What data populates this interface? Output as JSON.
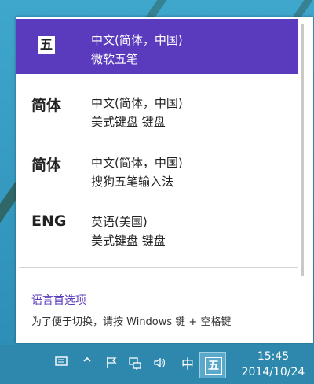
{
  "ime_flyout": {
    "items": [
      {
        "indicator": "五",
        "language": "中文(简体，中国)",
        "layout": "微软五笔",
        "selected": true
      },
      {
        "indicator": "简体",
        "language": "中文(简体，中国)",
        "layout": "美式键盘 键盘",
        "selected": false
      },
      {
        "indicator": "简体",
        "language": "中文(简体，中国)",
        "layout": "搜狗五笔输入法",
        "selected": false
      },
      {
        "indicator": "ENG",
        "language": "英语(美国)",
        "layout": "美式键盘 键盘",
        "selected": false
      }
    ],
    "preferences_link": "语言首选项",
    "switch_hint": "为了便于切换，请按 Windows 键 + 空格键"
  },
  "taskbar": {
    "tray_icons": [
      "action-center-icon",
      "show-hidden-icons-chevron",
      "flag-icon",
      "network-icon",
      "volume-icon"
    ],
    "language_indicator": "中",
    "ime_mode": "五",
    "clock": {
      "time": "15:45",
      "date": "2014/10/24"
    }
  },
  "colors": {
    "accent": "#5b3bbd",
    "taskbar": "#2e87ac",
    "desktop": "#3fa6cc"
  }
}
